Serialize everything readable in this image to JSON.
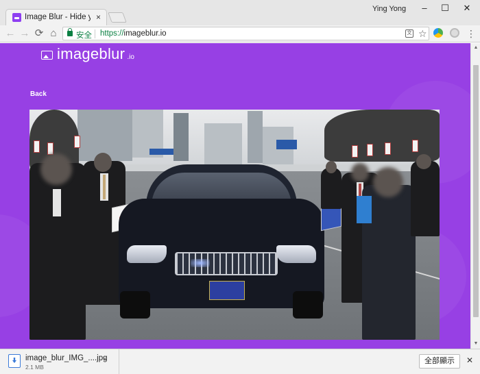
{
  "browser": {
    "tab_title": "Image Blur - Hide your ...",
    "tab_close": "×",
    "profile_name": "Ying Yong",
    "window_controls": {
      "minimize": "–",
      "maximize": "☐",
      "close": "✕"
    },
    "nav": {
      "back": "←",
      "forward": "→",
      "reload": "⟳",
      "home": "⌂"
    },
    "omnibox": {
      "secure_label": "安全",
      "url_scheme": "https://",
      "url_host": "imageblur.io"
    },
    "icons": {
      "translate": "translate-icon",
      "star": "☆",
      "menu": "⋮"
    }
  },
  "page": {
    "logo_text": "imageblur",
    "logo_tld": ".io",
    "back_label": "Back",
    "accent_color": "#9740e4"
  },
  "download_bar": {
    "file_name": "image_blur_IMG_....jpg",
    "file_size": "2.1 MB",
    "chevron": "^",
    "show_all_label": "全部顯示",
    "close": "✕"
  },
  "scrollbar": {
    "up": "▲",
    "down": "▼"
  }
}
